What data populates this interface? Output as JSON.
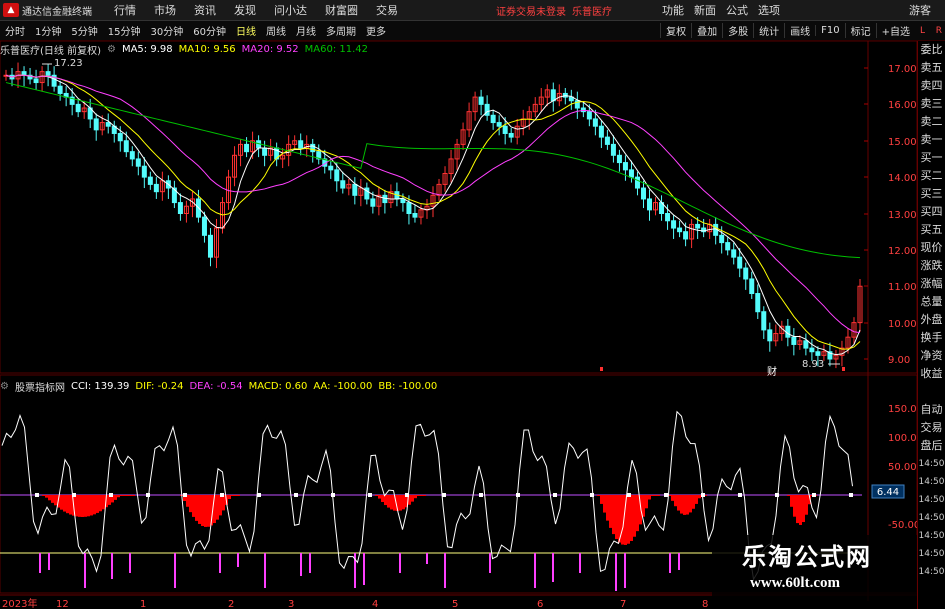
{
  "titlebar": {
    "app_title": "通达信金融终端",
    "menus": [
      "行情",
      "市场",
      "资讯",
      "发现",
      "问小达",
      "财富圈",
      "交易"
    ],
    "warning": "证券交易未登录",
    "stock": "乐普医疗",
    "right_menus": [
      "功能",
      "新面",
      "公式",
      "选项"
    ],
    "guest": "游客"
  },
  "toolbar": {
    "periods": [
      "分时",
      "1分钟",
      "5分钟",
      "15分钟",
      "30分钟",
      "60分钟",
      "日线",
      "周线",
      "月线",
      "多周期",
      "更多"
    ],
    "active_period": "日线",
    "buttons": [
      "复权",
      "叠加",
      "多股",
      "统计",
      "画线",
      "F10",
      "标记",
      "+自选"
    ]
  },
  "main_chart": {
    "title": "乐普医疗(日线 前复权)",
    "ma5": "MA5: 9.98",
    "ma10": "MA10: 9.56",
    "ma20": "MA20: 9.52",
    "ma60": "MA60: 11.42",
    "high_label": "17.23",
    "low_label": "8.93",
    "price_ticks": [
      "17.00",
      "16.00",
      "15.00",
      "14.00",
      "13.00",
      "12.00",
      "11.00",
      "10.00",
      "9.00"
    ],
    "marker_cai": "财",
    "colors": {
      "up": "#ff3232",
      "down": "#54fcfc",
      "ma5": "#ffffff",
      "ma10": "#ffff00",
      "ma20": "#ff40ff",
      "ma60": "#00c000"
    }
  },
  "sub_chart": {
    "title": "股票指标网",
    "cci": "CCI: 139.39",
    "dif": "DIF: -0.24",
    "dea": "DEA: -0.54",
    "macd": "MACD: 0.60",
    "aa": "AA: -100.00",
    "bb": "BB: -100.00",
    "ticks": [
      "150.0",
      "100.0",
      "50.00",
      "-50.00"
    ],
    "current_value": "6.44",
    "colors": {
      "cci": "#ffffff",
      "dif": "#ffff00",
      "dea": "#ff40ff",
      "macd": "#ff4040",
      "bar": "#ff0000"
    }
  },
  "date_axis": [
    "2023年",
    "12",
    "1",
    "2",
    "3",
    "4",
    "5",
    "6",
    "7",
    "8"
  ],
  "side_panel": {
    "corner_left": "L",
    "corner_right": "R",
    "items": [
      "委比",
      "卖五",
      "卖四",
      "卖三",
      "卖二",
      "卖一",
      "买一",
      "买二",
      "买三",
      "买四",
      "买五",
      "现价",
      "涨跌",
      "涨幅",
      "总量",
      "外盘",
      "换手",
      "净资",
      "收益",
      "",
      "自动",
      "交易",
      "盘后",
      "14:50",
      "14:50",
      "14:50",
      "14:50",
      "14:50",
      "14:50",
      "14:50"
    ]
  },
  "watermark": {
    "title": "乐淘公式网",
    "url": "www.60lt.com"
  }
}
